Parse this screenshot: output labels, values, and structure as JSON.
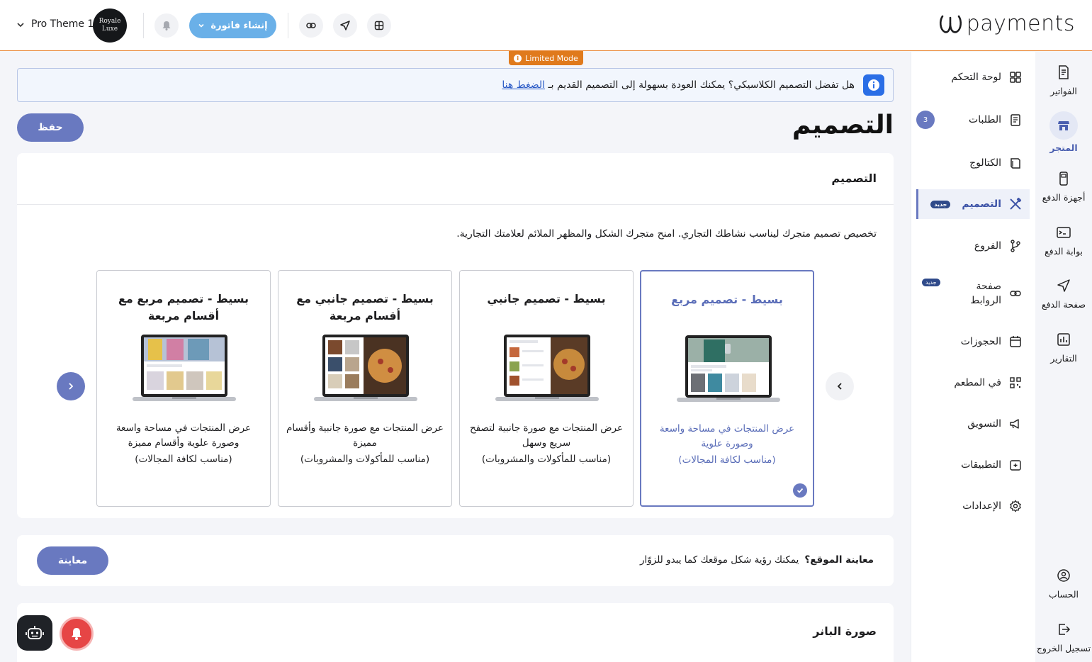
{
  "brand": {
    "name": "payments"
  },
  "header": {
    "theme_name": "Pro Theme 1",
    "avatar_text": "Royale Luxe",
    "create_invoice": "إنشاء فاتورة"
  },
  "limited_mode": "Limited Mode",
  "rail": [
    {
      "label": "الفواتير",
      "icon": "invoice-icon"
    },
    {
      "label": "المتجر",
      "icon": "store-icon"
    },
    {
      "label": "أجهزة الدفع",
      "icon": "pos-device-icon"
    },
    {
      "label": "بوابة الدفع",
      "icon": "gateway-icon"
    },
    {
      "label": "صفحة الدفع",
      "icon": "send-icon"
    },
    {
      "label": "التقارير",
      "icon": "reports-icon"
    },
    {
      "label": "الحساب",
      "icon": "account-icon"
    },
    {
      "label": "تسجيل الخروج",
      "icon": "logout-icon"
    }
  ],
  "menu": [
    {
      "label": "لوحة التحكم"
    },
    {
      "label": "الطلبات",
      "count": "3"
    },
    {
      "label": "الكتالوج"
    },
    {
      "label": "التصميم",
      "badge": "جديد"
    },
    {
      "label": "الفروع"
    },
    {
      "label": "صفحة الروابط",
      "badge": "جديد"
    },
    {
      "label": "الحجوزات"
    },
    {
      "label": "في المطعم"
    },
    {
      "label": "التسويق"
    },
    {
      "label": "التطبيقات"
    },
    {
      "label": "الإعدادات"
    }
  ],
  "notice": {
    "text": "هل تفضل التصميم الكلاسيكي؟ يمكنك العودة بسهولة إلى التصميم القديم بـ",
    "link": "الضغط هنا"
  },
  "page": {
    "title": "التصميم",
    "save": "حفظ"
  },
  "design_card": {
    "title": "التصميم",
    "description": "تخصيص تصميم متجرك ليناسب نشاطك التجاري. امنح متجرك الشكل والمظهر الملائم لعلامتك التجارية.",
    "themes": [
      {
        "title": "بسيط - تصميم مربع",
        "desc": "عرض المنتجات في مساحة واسعة وصورة علوية",
        "note": "(مناسب لكافة المجالات)",
        "selected": true
      },
      {
        "title": "بسيط - تصميم جانبي",
        "desc": "عرض المنتجات مع صورة جانبية لتصفح سريع وسهل",
        "note": "(مناسب للمأكولات والمشروبات)",
        "selected": false
      },
      {
        "title": "بسيط - تصميم جانبي مع أقسام مربعة",
        "desc": "عرض المنتجات مع صورة جانبية وأقسام مميزة",
        "note": "(مناسب للمأكولات والمشروبات)",
        "selected": false
      },
      {
        "title": "بسيط - تصميم مربع مع أقسام مربعة",
        "desc": "عرض المنتجات في مساحة واسعة وصورة علوية وأقسام مميزة",
        "note": "(مناسب لكافة المجالات)",
        "selected": false
      }
    ]
  },
  "preview_card": {
    "label": "معاينة الموقع؟",
    "text": "يمكنك رؤية شكل موقعك كما يبدو للزوّار",
    "button": "معاينة"
  },
  "banner_card": {
    "title": "صورة البانر"
  },
  "colors": {
    "accent": "#6979c0",
    "invoice_button": "#6ab0e8",
    "limited": "#e07a1c"
  }
}
